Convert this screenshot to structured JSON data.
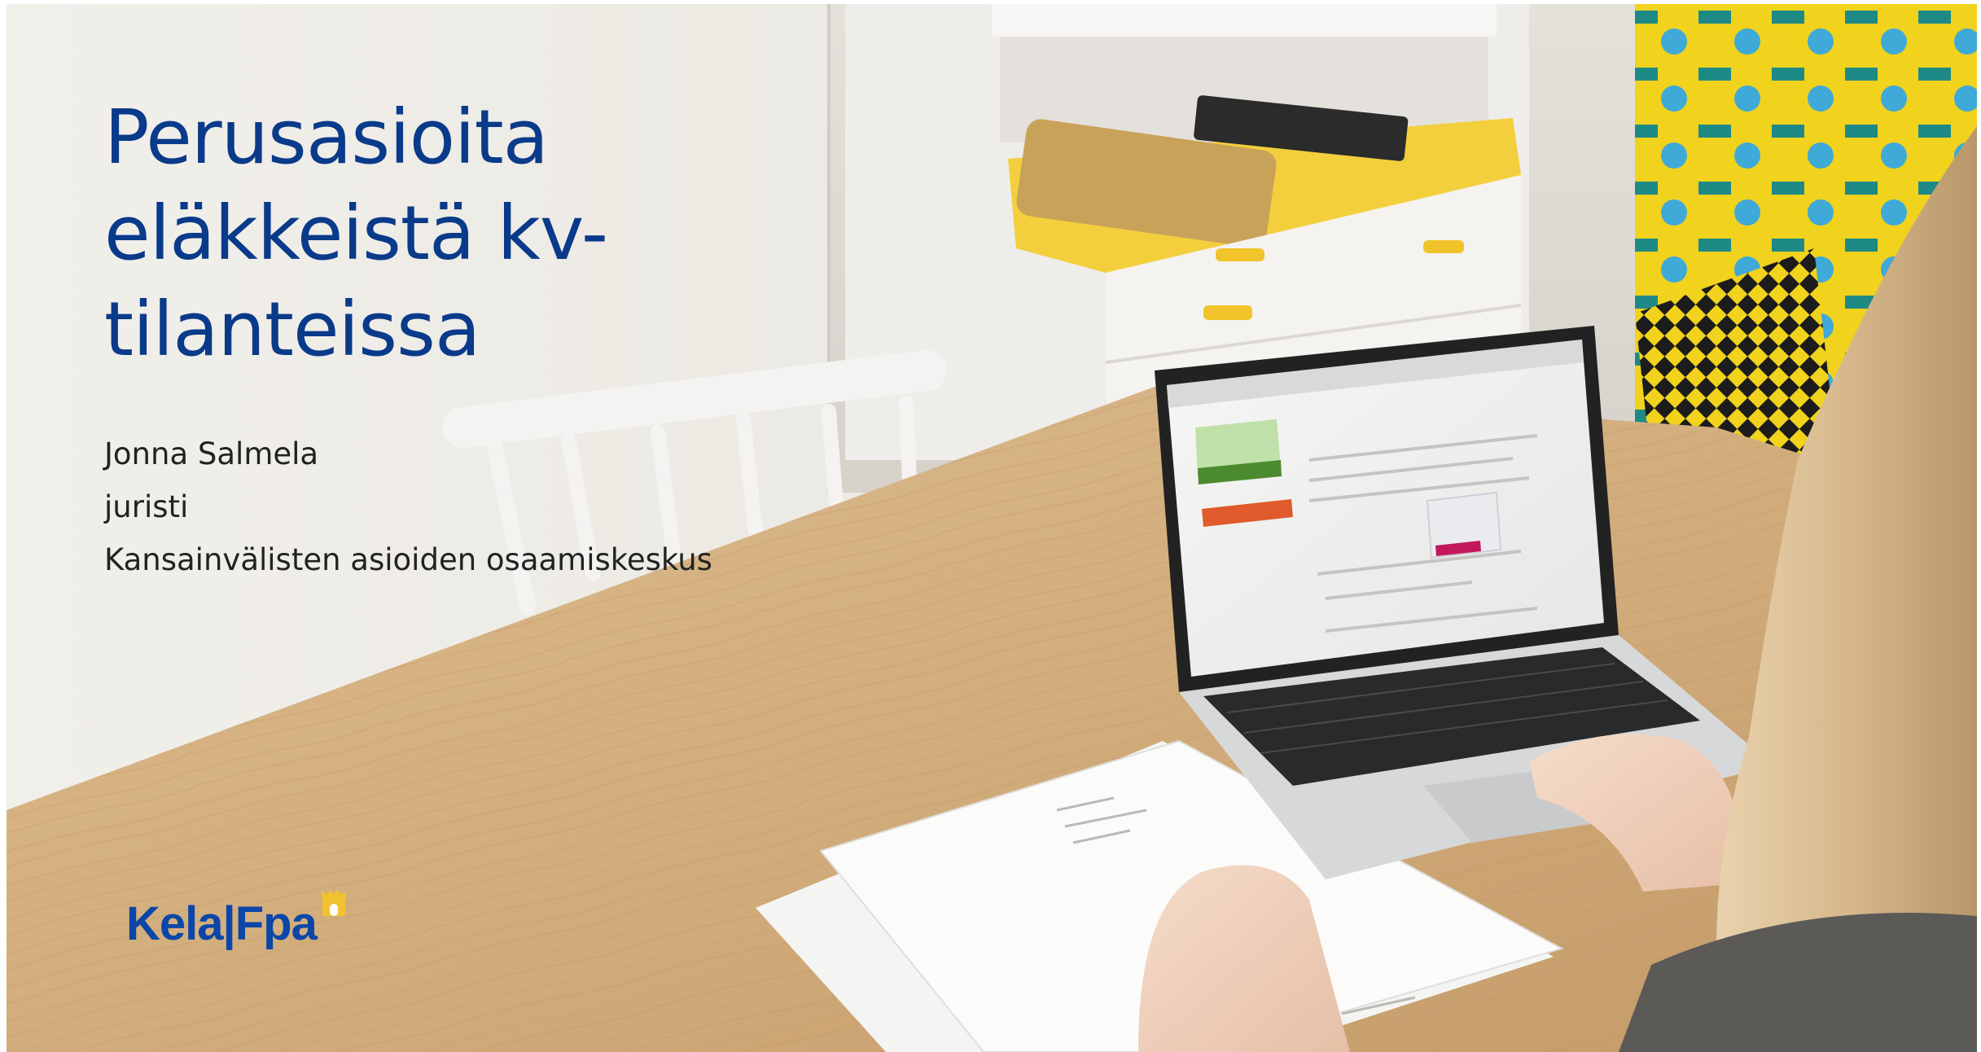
{
  "title": "Perusasioita eläkkeistä kv-tilanteissa",
  "presenter": {
    "name": "Jonna Salmela",
    "role": "juristi",
    "unit": "Kansainvälisten asioiden osaamiskeskus"
  },
  "logo": {
    "text": "Kela|Fpa",
    "mark_icon": "crown-house-icon"
  },
  "background_photo": {
    "icon": "person-at-laptop-photo"
  },
  "colors": {
    "title": "#0a3a8a",
    "logo": "#0b46a8",
    "logo_mark": "#f2c230",
    "text": "#222222",
    "table_wood": "#d2ad7c",
    "wall": "#ece9e3"
  }
}
